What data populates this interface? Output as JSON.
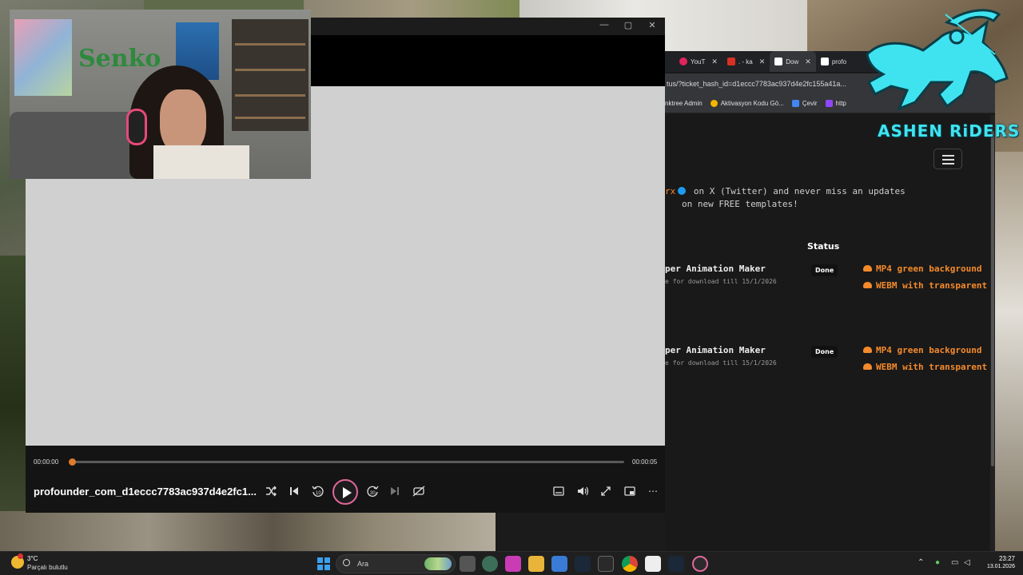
{
  "browser": {
    "tabs": [
      {
        "label": "YouT",
        "icon": "youtube-icon",
        "color": "#e0245e"
      },
      {
        "label": ". - ka",
        "icon": "gmail-icon",
        "color": "#d93025"
      },
      {
        "label": "Dow",
        "icon": "profounder-icon",
        "color": "#ffffff"
      },
      {
        "label": "profo",
        "icon": "profounder-icon",
        "color": "#ffffff"
      }
    ],
    "url": "tus/?ticket_hash_id=d1eccc7783ac937d4e2fc155a41a...",
    "bookmarks": [
      {
        "label": "nktree Admin",
        "color": ""
      },
      {
        "label": "Aktivasyon Kodu Gö...",
        "color": "#f4b400"
      },
      {
        "label": "Çevir",
        "color": "#4285f4"
      },
      {
        "label": "http",
        "color": "#9146ff"
      }
    ],
    "page": {
      "follow_handle": "rx",
      "follow_line1": "on X (Twitter) and never miss an updates",
      "follow_line2": "on new FREE templates!",
      "status_header": "Status",
      "jobs": [
        {
          "title": "per Animation Maker",
          "subtitle": "e for download till 15/1/2026",
          "status": "Done",
          "links": [
            "MP4 green background",
            "WEBM with transparent"
          ]
        },
        {
          "title": "per Animation Maker",
          "subtitle": "e for download till 15/1/2026",
          "status": "Done",
          "links": [
            "MP4 green background",
            "WEBM with transparent"
          ]
        }
      ]
    }
  },
  "overlay": {
    "logo_text": "ASHEN RiDERS",
    "webcam_sign": "Senko"
  },
  "player": {
    "window_controls": [
      "—",
      "▢",
      "✕"
    ],
    "current_time": "00:00:00",
    "total_time": "00:00:05",
    "progress": 0.0,
    "filename": "profounder_com_d1eccc7783ac937d4e2fc1...",
    "rewind_label": "10",
    "forward_label": "30",
    "accent_color": "#e07a2c"
  },
  "taskbar": {
    "temperature": "3°C",
    "weather": "Parçalı bulutlu",
    "search_placeholder": "Ara",
    "time": "23:27",
    "date": "13.01.2026"
  }
}
